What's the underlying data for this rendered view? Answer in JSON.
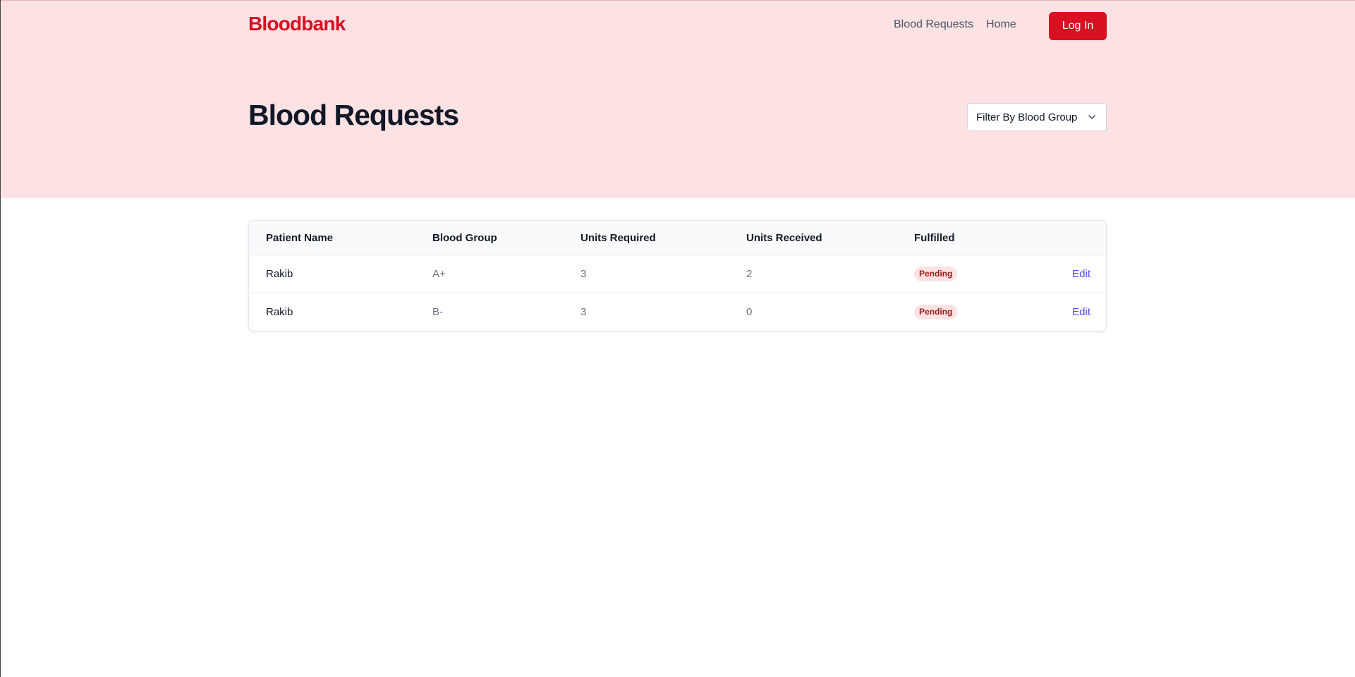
{
  "navbar": {
    "brand": "Bloodbank",
    "links": [
      "Blood Requests",
      "Home"
    ],
    "login_label": "Log In"
  },
  "page": {
    "title": "Blood Requests",
    "filter_label": "Filter By Blood Group"
  },
  "table": {
    "headers": [
      "Patient Name",
      "Blood Group",
      "Units Required",
      "Units Received",
      "Fulfilled"
    ],
    "rows": [
      {
        "patient_name": "Rakib",
        "blood_group": "A+",
        "units_required": "3",
        "units_received": "2",
        "fulfilled": "Pending",
        "action": "Edit"
      },
      {
        "patient_name": "Rakib",
        "blood_group": "B-",
        "units_required": "3",
        "units_received": "0",
        "fulfilled": "Pending",
        "action": "Edit"
      }
    ]
  },
  "colors": {
    "brand": "#d90f22",
    "hero_background": "#fde2e4",
    "link_accent": "#4f46e5",
    "pending_badge_text": "#991b1b"
  },
  "icons": {
    "filter_dropdown": "chevron-down-icon"
  }
}
